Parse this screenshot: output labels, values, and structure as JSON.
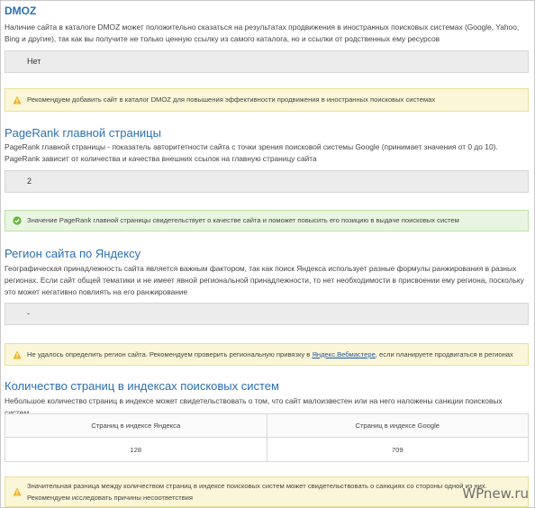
{
  "dmoz": {
    "title": "DMOZ",
    "description": "Наличие сайта в каталоге DMOZ может положительно сказаться на результатах продвижения в иностранных поисковых системах (Google, Yahoo, Bing и другие), так как вы получите не только ценную ссылку из самого каталога, но и ссылки от родственных ему ресурсов",
    "value": "Нет",
    "alert": "Рекомендуем добавить сайт в каталог DMOZ для повышения эффективности продвижения в иностранных поисковых системах",
    "alert_type": "warning"
  },
  "pagerank": {
    "title": "PageRank главной страницы",
    "description": "PageRank главной страницы - показатель авторитетности сайта с точки зрения поисковой системы Google (принимает значения от 0 до 10). PageRank зависит от количества и качества внешних ссылок на главную страницу сайта",
    "value": "2",
    "alert": "Значение PageRank главной страницы свидетельствует о качестве сайта и поможет повысить его позицию в выдаче поисковых систем",
    "alert_type": "success"
  },
  "region": {
    "title": "Регион сайта по Яндексу",
    "description": "Географическая принадлежность сайта является важным фактором, так как поиск Яндекса использует разные формулы ранжирования в разных регионах. Если сайт общей тематики и не имеет явной региональной принадлежности, то нет необходимости в присвоении ему региона, поскольку это может негативно повлиять на его ранжирование",
    "value": "-",
    "alert_before": "Не удалось определить регион сайта. Рекомендуем проверить региональную привязку в ",
    "alert_link": "Яндекс.Вебмастере",
    "alert_after": ", если планируете продвигаться в регионах",
    "alert_type": "warning"
  },
  "index": {
    "title": "Количество страниц в индексах поисковых систем",
    "description": "Небольшое количество страниц в индексе может свидетельствовать о том, что сайт малоизвестен или на него наложены санкции поисковых систем",
    "col_yandex": "Страниц в индексе Яндекса",
    "col_google": "Страниц в индексе Google",
    "val_yandex": "128",
    "val_google": "709",
    "alert": "Значительная разница между количеством страниц в индексе поисковых систем может свидетельствовать о санкциях со стороны одной из них. Рекомендуем исследовать причины несоответствия",
    "alert_type": "warning"
  },
  "watermark": "WPnew.ru",
  "colors": {
    "heading": "#2b6fb4",
    "warning_bg": "#fbf6d7",
    "success_bg": "#e8f6e1",
    "value_bg": "#ececec"
  }
}
